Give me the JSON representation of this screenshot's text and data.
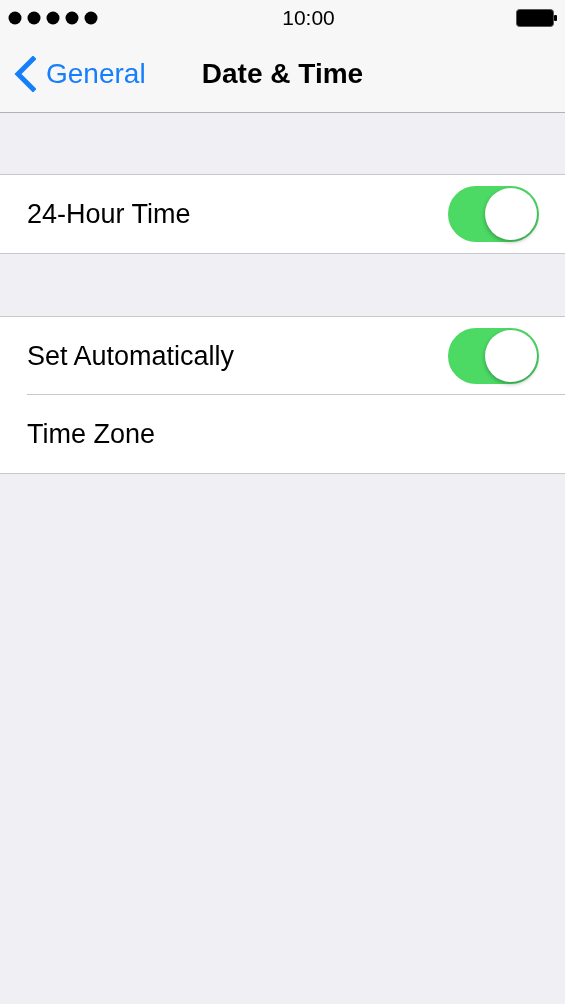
{
  "status_bar": {
    "time": "10:00"
  },
  "nav_bar": {
    "back_label": "General",
    "title": "Date & Time"
  },
  "sections": [
    {
      "rows": [
        {
          "kind": "toggle",
          "label": "24-Hour Time",
          "on": true
        }
      ]
    },
    {
      "rows": [
        {
          "kind": "toggle",
          "label": "Set Automatically",
          "on": true
        },
        {
          "kind": "plain",
          "label": "Time Zone"
        }
      ]
    }
  ]
}
